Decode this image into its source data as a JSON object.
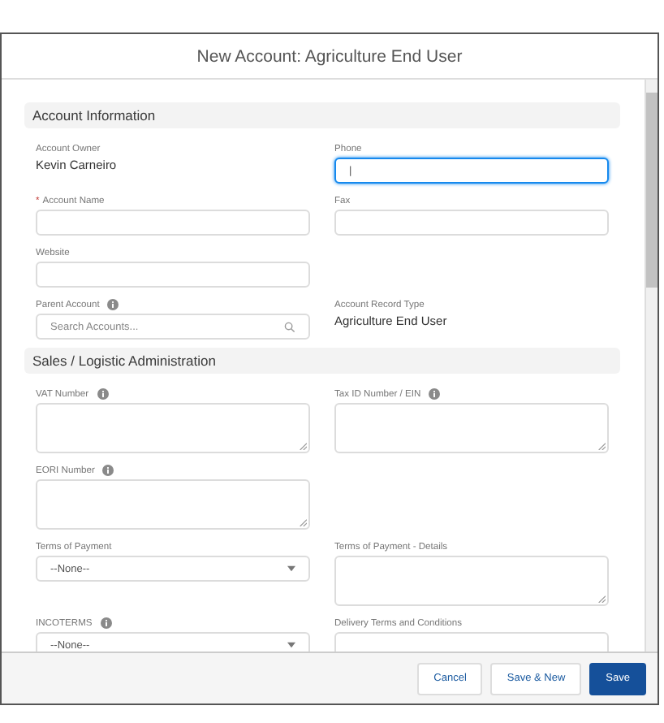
{
  "modal": {
    "title": "New Account: Agriculture End User"
  },
  "required_marker": "*",
  "sections": [
    {
      "title": "Account Information",
      "rows": [
        {
          "left": {
            "kind": "readonly",
            "label": "Account Owner",
            "value": "Kevin Carneiro",
            "required": false,
            "help": false
          },
          "right": {
            "kind": "text",
            "label": "Phone",
            "value": "|",
            "required": false,
            "help": false,
            "focused": true
          }
        },
        {
          "left": {
            "kind": "text",
            "label": "Account Name",
            "required": true,
            "help": false,
            "focused": false
          },
          "right": {
            "kind": "text",
            "label": "Fax",
            "required": false,
            "help": false,
            "focused": false
          }
        },
        {
          "left": {
            "kind": "text",
            "label": "Website",
            "required": false,
            "help": false,
            "focused": false
          },
          "right": null
        },
        {
          "left": {
            "kind": "lookup",
            "label": "Parent Account",
            "placeholder": "Search Accounts...",
            "required": false,
            "help": true,
            "focused": false
          },
          "right": {
            "kind": "readonly",
            "label": "Account Record Type",
            "value": "Agriculture End User",
            "required": false,
            "help": false
          }
        }
      ]
    },
    {
      "title": "Sales / Logistic Administration",
      "rows": [
        {
          "left": {
            "kind": "textarea",
            "label": "VAT Number",
            "required": false,
            "help": true,
            "focused": false
          },
          "right": {
            "kind": "textarea",
            "label": "Tax ID Number / EIN",
            "required": false,
            "help": true,
            "focused": false
          }
        },
        {
          "left": {
            "kind": "textarea",
            "label": "EORI Number",
            "required": false,
            "help": true,
            "focused": false
          },
          "right": null
        },
        {
          "left": {
            "kind": "select",
            "label": "Terms of Payment",
            "value": "--None--",
            "required": false,
            "help": false,
            "focused": false
          },
          "right": {
            "kind": "textarea",
            "label": "Terms of Payment - Details",
            "required": false,
            "help": false,
            "focused": false
          }
        },
        {
          "left": {
            "kind": "select",
            "label": "INCOTERMS",
            "value": "--None--",
            "required": false,
            "help": true,
            "focused": false
          },
          "right": {
            "kind": "textarea",
            "label": "Delivery Terms and Conditions",
            "required": false,
            "help": false,
            "focused": false
          }
        }
      ]
    }
  ],
  "buttons": [
    {
      "label": "Cancel",
      "kind": "neutral"
    },
    {
      "label": "Save & New",
      "kind": "neutral"
    },
    {
      "label": "Save",
      "kind": "brand"
    }
  ]
}
